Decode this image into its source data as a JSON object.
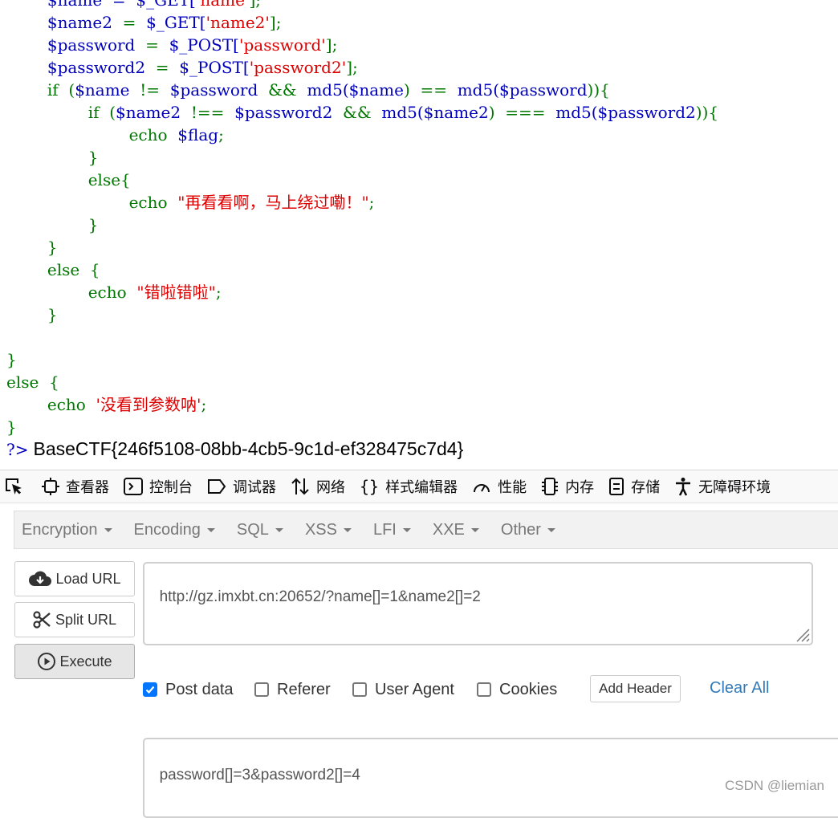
{
  "code": {
    "lines": [
      [
        {
          "t": "        $name  =  ",
          "c": "vr"
        },
        {
          "t": "$_GET[",
          "c": "vr"
        },
        {
          "t": "'name'",
          "c": "st"
        },
        {
          "t": "];",
          "c": "kw"
        }
      ],
      [
        {
          "t": "        ",
          "c": "kw"
        },
        {
          "t": "$name2",
          "c": "vr"
        },
        {
          "t": "  =  ",
          "c": "kw"
        },
        {
          "t": "$_GET[",
          "c": "vr"
        },
        {
          "t": "'name2'",
          "c": "st"
        },
        {
          "t": "];",
          "c": "kw"
        }
      ],
      [
        {
          "t": "        ",
          "c": "kw"
        },
        {
          "t": "$password",
          "c": "vr"
        },
        {
          "t": "  =  ",
          "c": "kw"
        },
        {
          "t": "$_POST[",
          "c": "vr"
        },
        {
          "t": "'password'",
          "c": "st"
        },
        {
          "t": "];",
          "c": "kw"
        }
      ],
      [
        {
          "t": "        ",
          "c": "kw"
        },
        {
          "t": "$password2",
          "c": "vr"
        },
        {
          "t": "  =  ",
          "c": "kw"
        },
        {
          "t": "$_POST[",
          "c": "vr"
        },
        {
          "t": "'password2'",
          "c": "st"
        },
        {
          "t": "];",
          "c": "kw"
        }
      ],
      [
        {
          "t": "        if  (",
          "c": "kw"
        },
        {
          "t": "$name",
          "c": "vr"
        },
        {
          "t": "  !=  ",
          "c": "kw"
        },
        {
          "t": "$password",
          "c": "vr"
        },
        {
          "t": "  &&  ",
          "c": "kw"
        },
        {
          "t": "md5(",
          "c": "vr"
        },
        {
          "t": "$name",
          "c": "vr"
        },
        {
          "t": ")  ==  ",
          "c": "kw"
        },
        {
          "t": "md5(",
          "c": "vr"
        },
        {
          "t": "$password",
          "c": "vr"
        },
        {
          "t": ")){",
          "c": "kw"
        }
      ],
      [
        {
          "t": "                if  (",
          "c": "kw"
        },
        {
          "t": "$name2",
          "c": "vr"
        },
        {
          "t": "  !==  ",
          "c": "kw"
        },
        {
          "t": "$password2",
          "c": "vr"
        },
        {
          "t": "  &&  ",
          "c": "kw"
        },
        {
          "t": "md5(",
          "c": "vr"
        },
        {
          "t": "$name2",
          "c": "vr"
        },
        {
          "t": ")  ===  ",
          "c": "kw"
        },
        {
          "t": "md5(",
          "c": "vr"
        },
        {
          "t": "$password2",
          "c": "vr"
        },
        {
          "t": ")){",
          "c": "kw"
        }
      ],
      [
        {
          "t": "                        echo  ",
          "c": "kw"
        },
        {
          "t": "$flag",
          "c": "vr"
        },
        {
          "t": ";",
          "c": "kw"
        }
      ],
      [
        {
          "t": "                }",
          "c": "kw"
        }
      ],
      [
        {
          "t": "                else{",
          "c": "kw"
        }
      ],
      [
        {
          "t": "                        echo  ",
          "c": "kw"
        },
        {
          "t": "\"再看看啊，马上绕过嘞！\"",
          "c": "st"
        },
        {
          "t": ";",
          "c": "kw"
        }
      ],
      [
        {
          "t": "                }",
          "c": "kw"
        }
      ],
      [
        {
          "t": "        }",
          "c": "kw"
        }
      ],
      [
        {
          "t": "        else  {",
          "c": "kw"
        }
      ],
      [
        {
          "t": "                echo  ",
          "c": "kw"
        },
        {
          "t": "\"错啦错啦\"",
          "c": "st"
        },
        {
          "t": ";",
          "c": "kw"
        }
      ],
      [
        {
          "t": "        }",
          "c": "kw"
        }
      ],
      [
        {
          "t": "",
          "c": "kw"
        }
      ],
      [
        {
          "t": "}",
          "c": "kw"
        }
      ],
      [
        {
          "t": "else  {",
          "c": "kw"
        }
      ],
      [
        {
          "t": "        echo  ",
          "c": "kw"
        },
        {
          "t": "'没看到参数呐'",
          "c": "st"
        },
        {
          "t": ";",
          "c": "kw"
        }
      ],
      [
        {
          "t": "}",
          "c": "kw"
        }
      ]
    ],
    "php_close": "?>",
    "flag": "BaseCTF{246f5108-08bb-4cb5-9c1d-ef328475c7d4}"
  },
  "devtools": {
    "tabs": [
      {
        "label": "查看器",
        "icon": "inspector-icon"
      },
      {
        "label": "控制台",
        "icon": "console-icon"
      },
      {
        "label": "调试器",
        "icon": "debugger-icon"
      },
      {
        "label": "网络",
        "icon": "network-icon"
      },
      {
        "label": "样式编辑器",
        "icon": "style-editor-icon"
      },
      {
        "label": "性能",
        "icon": "performance-icon"
      },
      {
        "label": "内存",
        "icon": "memory-icon"
      },
      {
        "label": "存储",
        "icon": "storage-icon"
      },
      {
        "label": "无障碍环境",
        "icon": "accessibility-icon"
      }
    ]
  },
  "hackbar": {
    "menus": [
      "Encryption",
      "Encoding",
      "SQL",
      "XSS",
      "LFI",
      "XXE",
      "Other"
    ],
    "load_url": "Load URL",
    "split_url": "Split URL",
    "execute": "Execute",
    "url_value": "http://gz.imxbt.cn:20652/?name[]=1&name2[]=2",
    "options": {
      "post_data": "Post data",
      "referer": "Referer",
      "user_agent": "User Agent",
      "cookies": "Cookies",
      "post_checked": true
    },
    "add_header": "Add Header",
    "clear_all": "Clear All",
    "post_value": "password[]=3&password2[]=4"
  },
  "watermark": "CSDN @liemian",
  "colors": {
    "keyword": "#007700",
    "variable": "#0000bb",
    "string": "#dd0000",
    "link": "#337ab7",
    "checkbox": "#0075ff"
  }
}
